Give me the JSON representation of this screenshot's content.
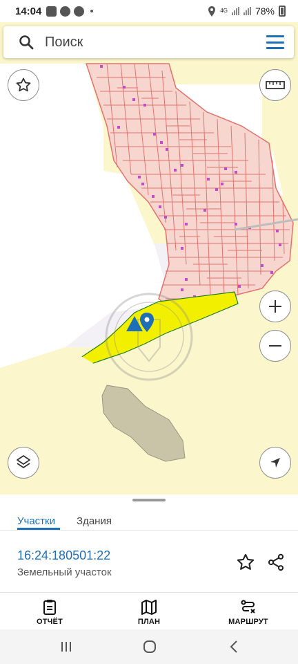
{
  "status": {
    "time": "14:04",
    "network": "4G",
    "battery": "78%"
  },
  "search": {
    "placeholder": "Поиск"
  },
  "map": {
    "icons": [
      "star-icon",
      "ruler-icon",
      "zoom-in-icon",
      "zoom-out-icon",
      "layers-icon",
      "navigation-arrow-icon"
    ],
    "colors": {
      "background": "#fbf6cc",
      "parcel_outline": "#e4726d",
      "parcel_fill": "#f7d6cf",
      "selected_parcel": "#f2f000",
      "building": "#c04ec7",
      "gray_area": "#c9c3a8"
    }
  },
  "sheet": {
    "tabs": [
      {
        "label": "Участки",
        "active": true
      },
      {
        "label": "Здания",
        "active": false
      }
    ],
    "parcel": {
      "cadastral_number": "16:24:180501:22",
      "type": "Земельный участок"
    },
    "bottom_nav": [
      {
        "label": "ОТЧЁТ",
        "icon": "clipboard-icon"
      },
      {
        "label": "ПЛАН",
        "icon": "map-icon"
      },
      {
        "label": "МАРШРУТ",
        "icon": "route-icon"
      }
    ]
  },
  "accent_color": "#1e6fb6"
}
